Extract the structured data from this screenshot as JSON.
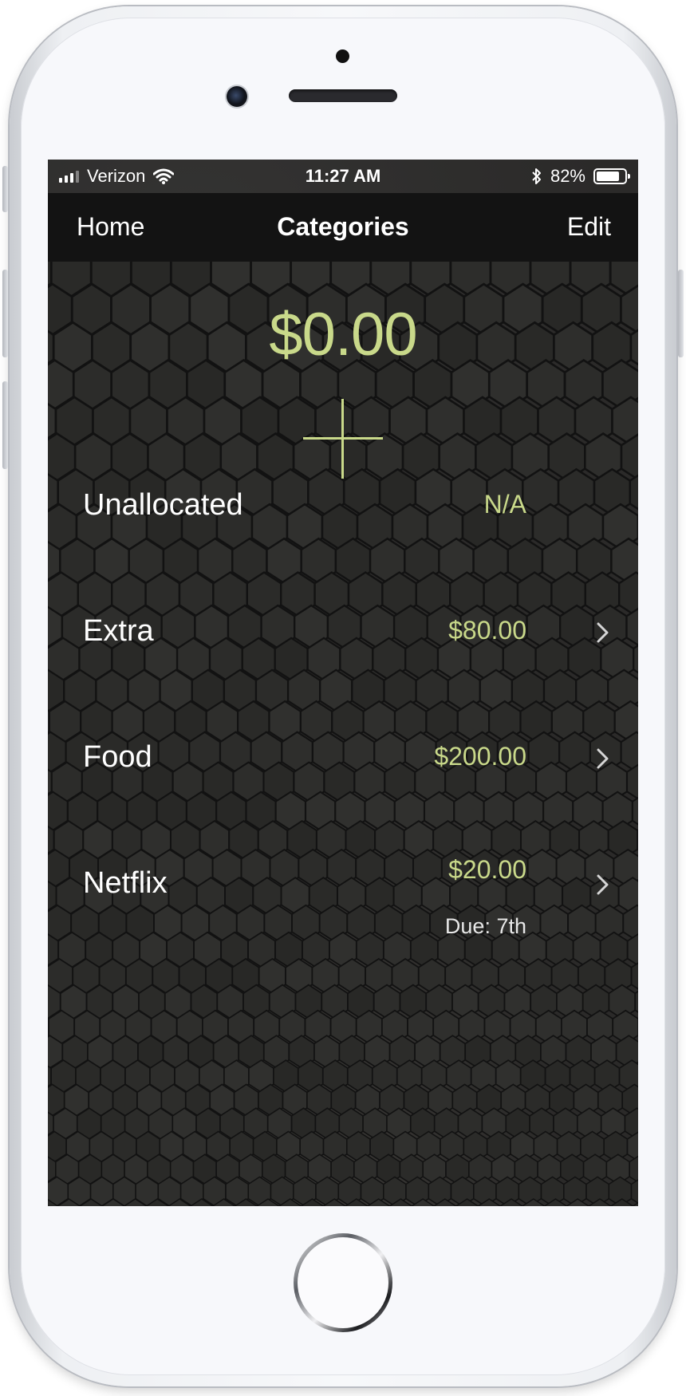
{
  "status_bar": {
    "carrier": "Verizon",
    "time": "11:27 AM",
    "battery_percent": "82%",
    "battery_level": 0.82
  },
  "nav_bar": {
    "left_label": "Home",
    "title": "Categories",
    "right_label": "Edit"
  },
  "summary": {
    "total": "$0.00"
  },
  "categories": [
    {
      "name": "Unallocated",
      "amount": "N/A",
      "due": ""
    },
    {
      "name": "Extra",
      "amount": "$80.00",
      "due": ""
    },
    {
      "name": "Food",
      "amount": "$200.00",
      "due": ""
    },
    {
      "name": "Netflix",
      "amount": "$20.00",
      "due": "Due: 7th"
    }
  ],
  "colors": {
    "accent": "#c9d98a",
    "nav_background": "#131313",
    "text": "#ffffff"
  },
  "icons": {
    "signal": "cellular-signal-icon",
    "wifi": "wifi-icon",
    "bluetooth": "bluetooth-icon",
    "battery": "battery-icon",
    "add": "plus-icon",
    "row_disclosure": "chevron-right-icon"
  }
}
